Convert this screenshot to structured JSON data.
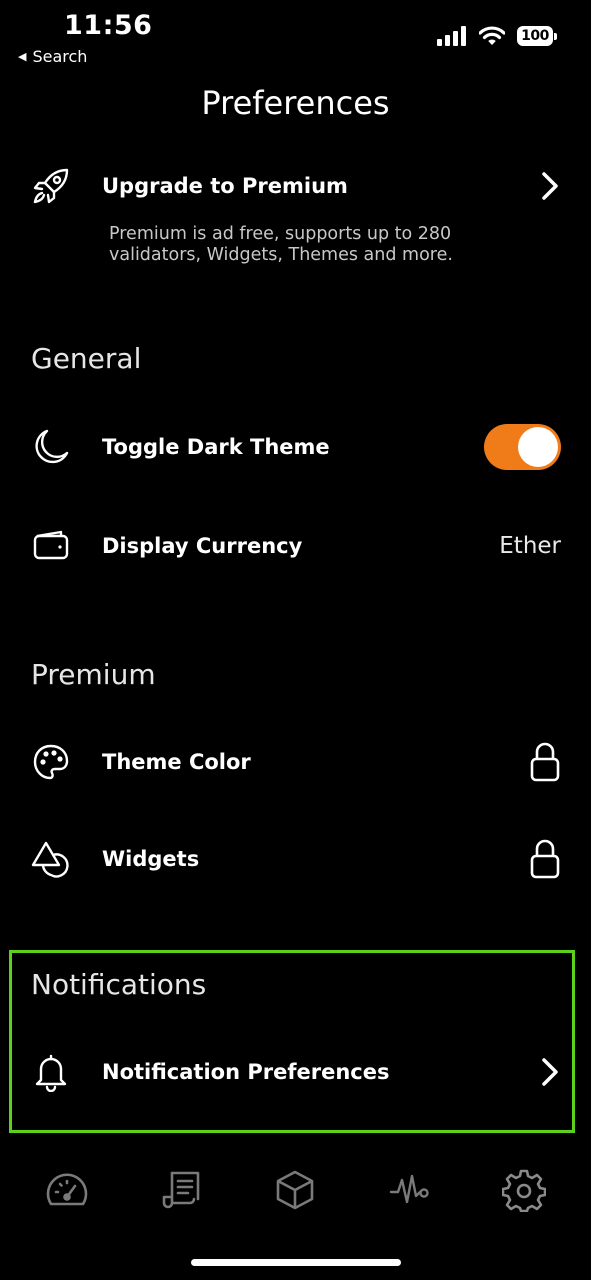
{
  "status_bar": {
    "time": "11:56",
    "back_label": "Search",
    "battery": "100"
  },
  "page_title": "Preferences",
  "upgrade": {
    "label": "Upgrade to Premium",
    "icon": "rocket-icon",
    "description_line1": "Premium is ad free, supports up to 280",
    "description_line2": "validators, Widgets, Themes and more."
  },
  "general": {
    "heading": "General",
    "dark_theme": {
      "label": "Toggle Dark Theme",
      "icon": "moon-icon",
      "enabled": true
    },
    "currency": {
      "label": "Display Currency",
      "icon": "wallet-icon",
      "value": "Ether"
    }
  },
  "premium": {
    "heading": "Premium",
    "theme_color": {
      "label": "Theme Color",
      "icon": "palette-icon",
      "locked": true
    },
    "widgets": {
      "label": "Widgets",
      "icon": "shapes-icon",
      "locked": true
    }
  },
  "notifications": {
    "heading": "Notifications",
    "preferences": {
      "label": "Notification Preferences",
      "icon": "bell-icon"
    }
  },
  "tabbar": [
    "dashboard-icon",
    "receipt-icon",
    "cube-icon",
    "activity-icon",
    "gear-icon"
  ],
  "colors": {
    "accent": "#f07b19",
    "highlight": "#5ad21c",
    "background": "#000000"
  }
}
